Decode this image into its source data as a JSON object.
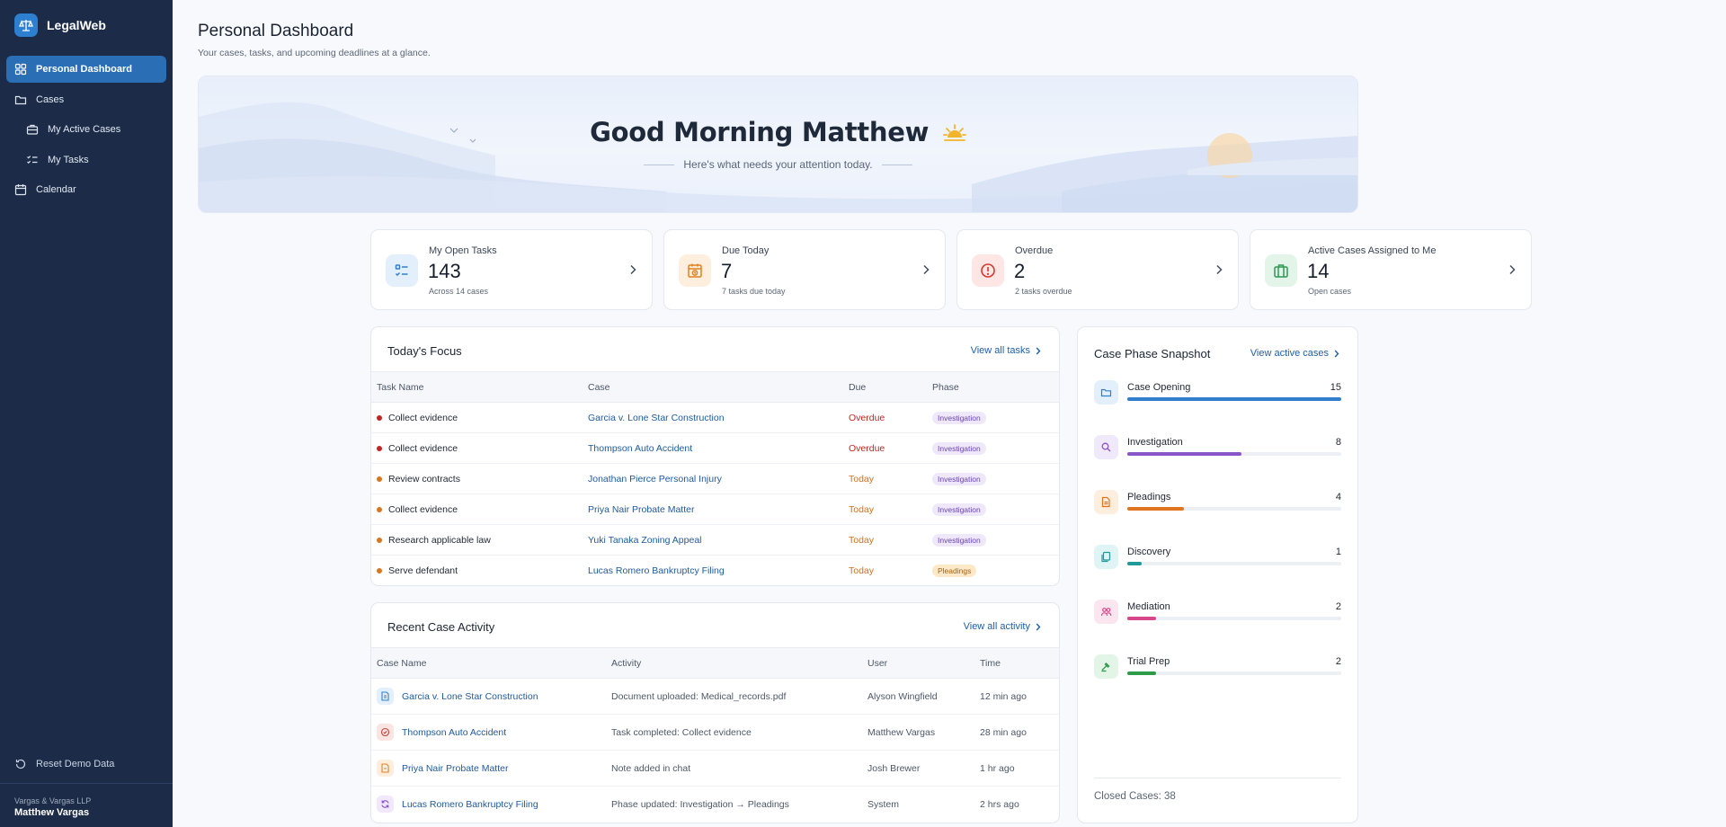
{
  "app": {
    "name": "LegalWeb"
  },
  "sidebar": {
    "items": [
      {
        "label": "Personal Dashboard",
        "icon": "dashboard-icon",
        "active": true
      },
      {
        "label": "Cases",
        "icon": "folder-icon"
      },
      {
        "label": "My Active Cases",
        "icon": "briefcase-icon",
        "sub": true
      },
      {
        "label": "My Tasks",
        "icon": "tasks-icon",
        "sub": true
      },
      {
        "label": "Calendar",
        "icon": "calendar-icon"
      }
    ],
    "reset_label": "Reset Demo Data",
    "firm": "Vargas & Vargas LLP",
    "user": "Matthew Vargas"
  },
  "page": {
    "title": "Personal Dashboard",
    "subtitle": "Your cases, tasks, and upcoming deadlines at a glance."
  },
  "hero": {
    "greeting": "Good Morning Matthew",
    "subtitle": "Here's what needs your attention today."
  },
  "stats": [
    {
      "label": "My Open Tasks",
      "value": "143",
      "note": "Across 14 cases",
      "icon": "checklist-icon",
      "color": "#2f7fce",
      "bg": "#e3f0fc"
    },
    {
      "label": "Due Today",
      "value": "7",
      "note": "7 tasks due today",
      "icon": "calendar-clock-icon",
      "color": "#e0811f",
      "bg": "#fdeedd"
    },
    {
      "label": "Overdue",
      "value": "2",
      "note": "2 tasks overdue",
      "icon": "alert-icon",
      "color": "#d03a30",
      "bg": "#fde6e4"
    },
    {
      "label": "Active Cases Assigned to Me",
      "value": "14",
      "note": "Open cases",
      "icon": "briefcase-icon",
      "color": "#2e9a55",
      "bg": "#e2f5e8"
    }
  ],
  "focus": {
    "title": "Today's Focus",
    "link": "View all tasks",
    "columns": [
      "Task Name",
      "Case",
      "Due",
      "Phase"
    ],
    "rows": [
      {
        "task": "Collect evidence",
        "case": "Garcia v. Lone Star Construction",
        "due": "Overdue",
        "phase": "Investigation"
      },
      {
        "task": "Collect evidence",
        "case": "Thompson Auto Accident",
        "due": "Overdue",
        "phase": "Investigation"
      },
      {
        "task": "Review contracts",
        "case": "Jonathan Pierce Personal Injury",
        "due": "Today",
        "phase": "Investigation"
      },
      {
        "task": "Collect evidence",
        "case": "Priya Nair Probate Matter",
        "due": "Today",
        "phase": "Investigation"
      },
      {
        "task": "Research applicable law",
        "case": "Yuki Tanaka Zoning Appeal",
        "due": "Today",
        "phase": "Investigation"
      },
      {
        "task": "Serve defendant",
        "case": "Lucas Romero Bankruptcy Filing",
        "due": "Today",
        "phase": "Pleadings"
      }
    ]
  },
  "activity": {
    "title": "Recent Case Activity",
    "link": "View all activity",
    "columns": [
      "Case Name",
      "Activity",
      "User",
      "Time"
    ],
    "rows": [
      {
        "case": "Garcia v. Lone Star Construction",
        "activity": "Document uploaded: Medical_records.pdf",
        "user": "Alyson Wingfield",
        "time": "12 min ago",
        "icon": "document-icon",
        "color": "#2f7fce",
        "bg": "#e3f0fc"
      },
      {
        "case": "Thompson Auto Accident",
        "activity": "Task completed: Collect evidence",
        "user": "Matthew Vargas",
        "time": "28 min ago",
        "icon": "check-circle-icon",
        "color": "#c2413a",
        "bg": "#fbe5e3"
      },
      {
        "case": "Priya Nair Probate Matter",
        "activity": "Note added in chat",
        "user": "Josh Brewer",
        "time": "1 hr ago",
        "icon": "note-icon",
        "color": "#e0811f",
        "bg": "#fdeedd"
      },
      {
        "case": "Lucas Romero Bankruptcy Filing",
        "activity": "Phase updated: Investigation → Pleadings",
        "user": "System",
        "time": "2 hrs ago",
        "icon": "refresh-icon",
        "color": "#8a4fc8",
        "bg": "#f1e8fb"
      }
    ]
  },
  "phases": {
    "title": "Case Phase Snapshot",
    "link": "View active cases",
    "max": 15,
    "items": [
      {
        "name": "Case Opening",
        "count": 15,
        "color": "#2f7fce",
        "bg": "#e3f0fc",
        "icon": "folder-icon"
      },
      {
        "name": "Investigation",
        "count": 8,
        "color": "#8a55c9",
        "bg": "#f0e8fb",
        "icon": "search-icon"
      },
      {
        "name": "Pleadings",
        "count": 4,
        "color": "#e07520",
        "bg": "#fdeedd",
        "icon": "document-icon"
      },
      {
        "name": "Discovery",
        "count": 1,
        "color": "#1f9a9a",
        "bg": "#dff4f4",
        "icon": "files-icon"
      },
      {
        "name": "Mediation",
        "count": 2,
        "color": "#d8478a",
        "bg": "#fbe5ef",
        "icon": "people-icon"
      },
      {
        "name": "Trial Prep",
        "count": 2,
        "color": "#2f9a4a",
        "bg": "#e2f5e6",
        "icon": "gavel-icon"
      }
    ],
    "closed": "Closed Cases: 38"
  }
}
